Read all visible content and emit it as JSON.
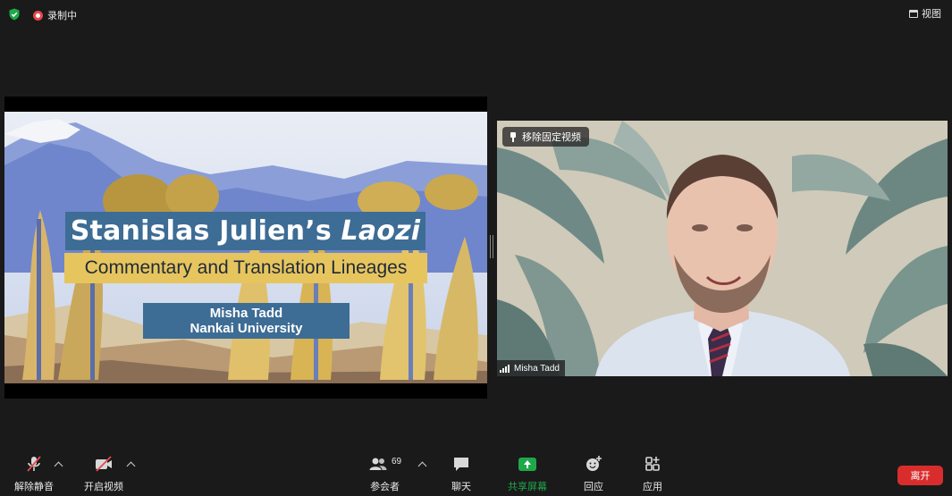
{
  "topbar": {
    "recording_label": "录制中",
    "view_label": "视图"
  },
  "shared_slide": {
    "title_main": "Stanislas Julien’s ",
    "title_italic": "Laozi",
    "subtitle": "Commentary and Translation Lineages",
    "author_name": "Misha Tadd",
    "author_affiliation": "Nankai University"
  },
  "speaker_video": {
    "unpin_label": "移除固定视频",
    "participant_name": "Misha Tadd"
  },
  "toolbar": {
    "unmute_label": "解除静音",
    "start_video_label": "开启视频",
    "participants_label": "参会者",
    "participants_count": "69",
    "chat_label": "聊天",
    "share_screen_label": "共享屏幕",
    "reactions_label": "回应",
    "apps_label": "应用",
    "leave_label": "离开"
  },
  "colors": {
    "background": "#1a1a1a",
    "share_green": "#1ea84b",
    "leave_red": "#d92d2d",
    "slide_blue": "#3d6c95",
    "slide_yellow": "#e7c55e"
  }
}
